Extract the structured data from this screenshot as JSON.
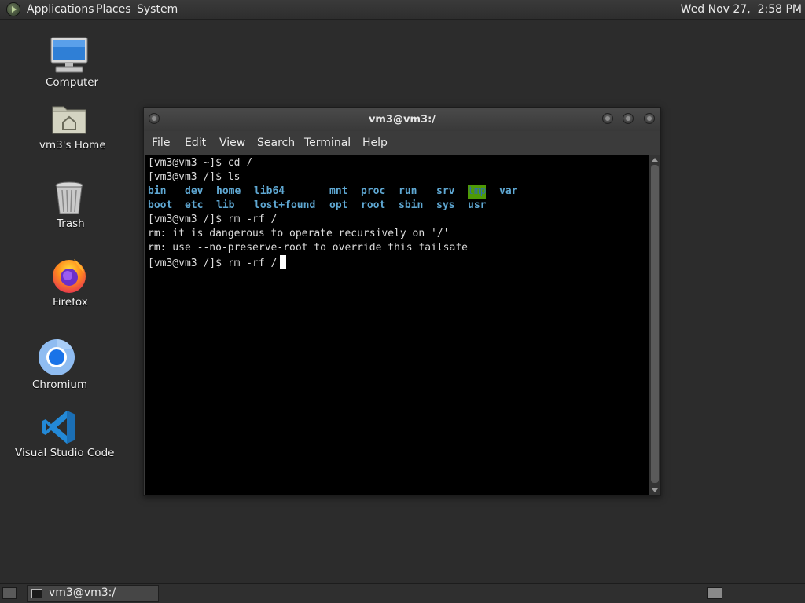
{
  "top_panel": {
    "menu": [
      "Applications",
      "Places",
      "System"
    ],
    "clock": "Wed Nov 27,  2:58 PM"
  },
  "desktop": {
    "icons": [
      {
        "label": "Computer",
        "icon": "computer-icon"
      },
      {
        "label": "vm3's Home",
        "icon": "home-folder-icon"
      },
      {
        "label": "Trash",
        "icon": "trash-icon"
      },
      {
        "label": "Firefox",
        "icon": "firefox-icon"
      },
      {
        "label": "Chromium",
        "icon": "chromium-icon"
      },
      {
        "label": "Visual Studio Code",
        "icon": "vscode-icon"
      }
    ]
  },
  "terminal": {
    "title": "vm3@vm3:/",
    "menu": [
      "File",
      "Edit",
      "View",
      "Search",
      "Terminal",
      "Help"
    ],
    "lines": [
      "[vm3@vm3 ~]$ cd /",
      "[vm3@vm3 /]$ ls",
      "[vm3@vm3 /]$ rm -rf /",
      "rm: it is dangerous to operate recursively on '/'",
      "rm: use --no-preserve-root to override this failsafe",
      "[vm3@vm3 /]$ rm -rf /"
    ],
    "ls_row1": [
      "bin",
      "dev",
      "home",
      "lib64",
      "mnt",
      "proc",
      "run",
      "srv",
      "tmp",
      "var"
    ],
    "ls_row2": [
      "boot",
      "etc",
      "lib",
      "lost+found",
      "opt",
      "root",
      "sbin",
      "sys",
      "usr"
    ],
    "highlighted_dir": "tmp",
    "colors": {
      "dir": "#5fa8d3",
      "highlight_bg": "#4e9a06",
      "background": "#000000"
    }
  },
  "taskbar": {
    "task_label": "vm3@vm3:/"
  }
}
